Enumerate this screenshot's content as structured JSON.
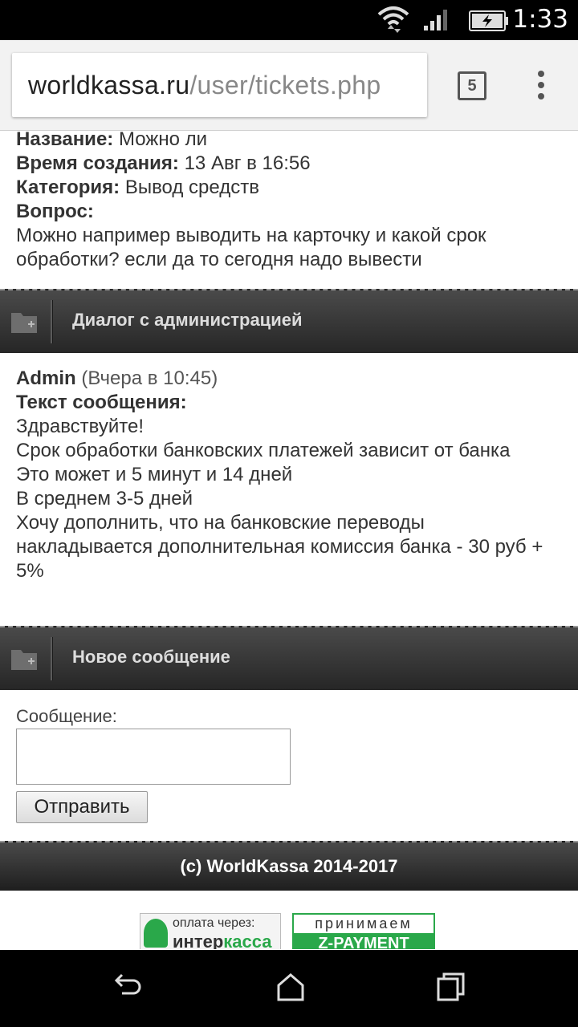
{
  "status": {
    "time": "1:33"
  },
  "browser": {
    "url_domain": "worldkassa.ru",
    "url_path": "/user/tickets.php",
    "tab_count": "5"
  },
  "ticket": {
    "name_label": "Название:",
    "name_value": "Можно ли",
    "created_label": "Время создания:",
    "created_value": "13 Авг в 16:56",
    "category_label": "Категория:",
    "category_value": "Вывод средств",
    "question_label": "Вопрос:",
    "question_text": "Можно например выводить на карточку и какой срок обработки? если да то сегодня надо вывести"
  },
  "dialog_section": {
    "title": "Диалог с администрацией"
  },
  "message": {
    "author": "Admin",
    "time": "(Вчера в 10:45)",
    "text_label": "Текст сообщения:",
    "lines": [
      "Здравствуйте!",
      "Срок обработки банковских платежей зависит от банка",
      "Это может и 5 минут и 14 дней",
      "В среднем 3-5 дней",
      "Хочу дополнить, что на банковские переводы накладывается дополнительная комиссия банка - 30 руб + 5%"
    ]
  },
  "new_message_section": {
    "title": "Новое сообщение"
  },
  "form": {
    "message_label": "Сообщение:",
    "message_value": "",
    "send_label": "Отправить"
  },
  "footer": {
    "copyright": "(c) WorldKassa 2014-2017"
  },
  "banners": {
    "interkassa_line1": "оплата через:",
    "interkassa_line2a": "интер",
    "interkassa_line2b": "касса",
    "zpayment_line1": "принимаем",
    "zpayment_line2": "Z-PAYMENT"
  },
  "colors": {
    "accent_green": "#2aa84a",
    "bar_dark": "#2e2e2e"
  }
}
